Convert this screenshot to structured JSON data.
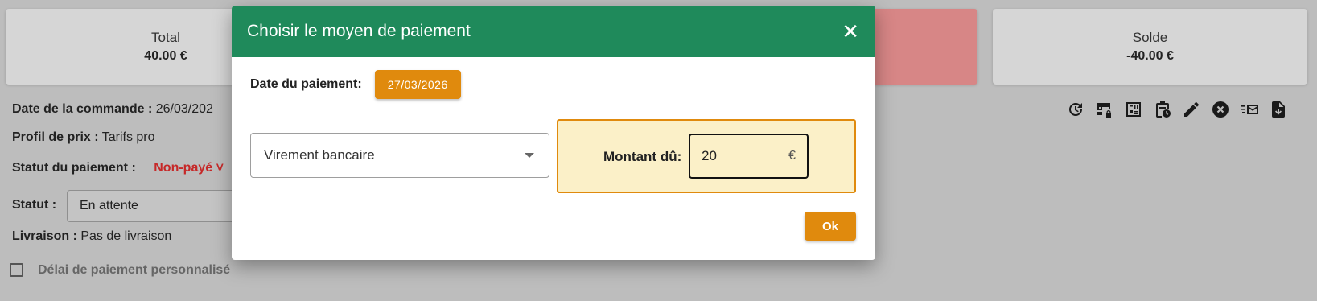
{
  "summary": {
    "total_label": "Total",
    "total_value": "40.00 €",
    "solde_label": "Solde",
    "solde_value": "-40.00 €"
  },
  "order": {
    "date_label": "Date de la commande :",
    "date_value": "26/03/202",
    "profile_label": "Profil de prix :",
    "profile_value": "Tarifs pro",
    "payment_status_label": "Statut du paiement :",
    "payment_status_value": "Non-payé ˅",
    "status_label": "Statut :",
    "status_value": "En attente",
    "delivery_label": "Livraison :",
    "delivery_value": "Pas de livraison",
    "custom_delay_label": "Délai de paiement personnalisé"
  },
  "modal": {
    "title": "Choisir le moyen de paiement",
    "date_label": "Date du paiement:",
    "date_value": "27/03/2026",
    "method_value": "Virement bancaire",
    "amount_label": "Montant dû:",
    "amount_value": "20",
    "currency": "€",
    "ok_label": "Ok"
  },
  "colors": {
    "header": "#1f8a5b",
    "accent": "#e08a0d",
    "amount_bg": "#fbf0c8",
    "unpaid": "#c62828"
  },
  "toolbar_icons": [
    "history-icon",
    "table-lock-icon",
    "calculator-icon",
    "clipboard-clock-icon",
    "pencil-icon",
    "cancel-circle-icon",
    "email-list-icon",
    "file-download-icon"
  ]
}
